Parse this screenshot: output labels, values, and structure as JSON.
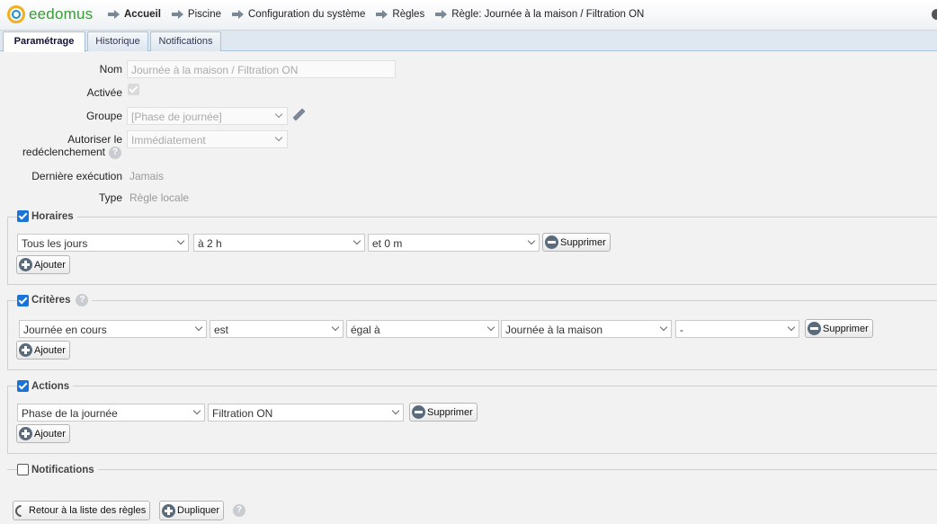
{
  "app": {
    "logo_text": "eedomus"
  },
  "breadcrumb": [
    {
      "label": "Accueil",
      "bold": true
    },
    {
      "label": "Piscine"
    },
    {
      "label": "Configuration du système"
    },
    {
      "label": "Règles"
    },
    {
      "label": "Règle: Journée à la maison / Filtration ON"
    }
  ],
  "tabs": [
    {
      "label": "Paramétrage",
      "active": true
    },
    {
      "label": "Historique"
    },
    {
      "label": "Notifications"
    }
  ],
  "form": {
    "nom_label": "Nom",
    "nom_value": "Journée à la maison / Filtration ON",
    "activee_label": "Activée",
    "groupe_label": "Groupe",
    "groupe_value": "[Phase de journée]",
    "autoriser_label_1": "Autoriser le",
    "autoriser_label_2": "redéclenchement",
    "autoriser_value": "Immédiatement",
    "derniere_label": "Dernière exécution",
    "derniere_value": "Jamais",
    "type_label": "Type",
    "type_value": "Règle locale",
    "help_glyph": "?"
  },
  "horaires": {
    "title": "Horaires",
    "checked": true,
    "row": {
      "day": "Tous les jours",
      "hour": "à 2 h",
      "minute": "et 0 m"
    },
    "delete_label": "Supprimer",
    "add_label": "Ajouter"
  },
  "criteres": {
    "title": "Critères",
    "checked": true,
    "row": {
      "subject": "Journée en cours",
      "verb": "est",
      "operator": "égal à",
      "value": "Journée à la maison",
      "extra": "-"
    },
    "delete_label": "Supprimer",
    "add_label": "Ajouter"
  },
  "actions": {
    "title": "Actions",
    "checked": true,
    "row": {
      "device": "Phase de la journée",
      "value": "Filtration ON"
    },
    "delete_label": "Supprimer",
    "add_label": "Ajouter"
  },
  "notifications": {
    "title": "Notifications",
    "checked": false
  },
  "footer": {
    "back_label": "Retour à la liste des règles",
    "duplicate_label": "Dupliquer"
  }
}
